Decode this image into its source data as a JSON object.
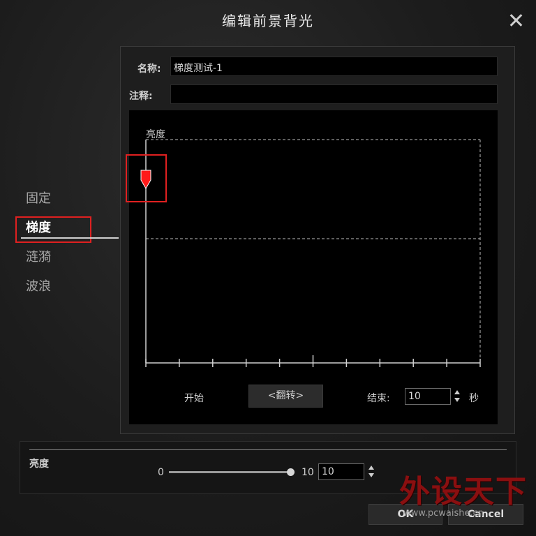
{
  "dialog": {
    "title": "编辑前景背光"
  },
  "sidebar": {
    "items": [
      {
        "label": "固定",
        "active": false
      },
      {
        "label": "梯度",
        "active": true
      },
      {
        "label": "涟漪",
        "active": false
      },
      {
        "label": "波浪",
        "active": false
      }
    ]
  },
  "form": {
    "name_label": "名称:",
    "name_value": "梯度测试-1",
    "note_label": "注释:",
    "note_value": ""
  },
  "graph": {
    "y_label": "亮度",
    "marker_position": 0.0,
    "tick_count": 11
  },
  "controls": {
    "start_label": "开始",
    "flip_label": "<翻转>",
    "end_label": "结束:",
    "end_value": "10",
    "unit_label": "秒"
  },
  "brightness": {
    "label": "亮度",
    "min_label": "0",
    "max_label": "10",
    "value": "10",
    "slider_fraction": 1.0
  },
  "buttons": {
    "ok": "OK",
    "cancel": "Cancel"
  },
  "watermark": {
    "text_cn": "外设天下",
    "text_url": "www.pcwaishe.cn"
  },
  "colors": {
    "accent_red": "#e02020",
    "marker_red": "#ff1a1a"
  }
}
